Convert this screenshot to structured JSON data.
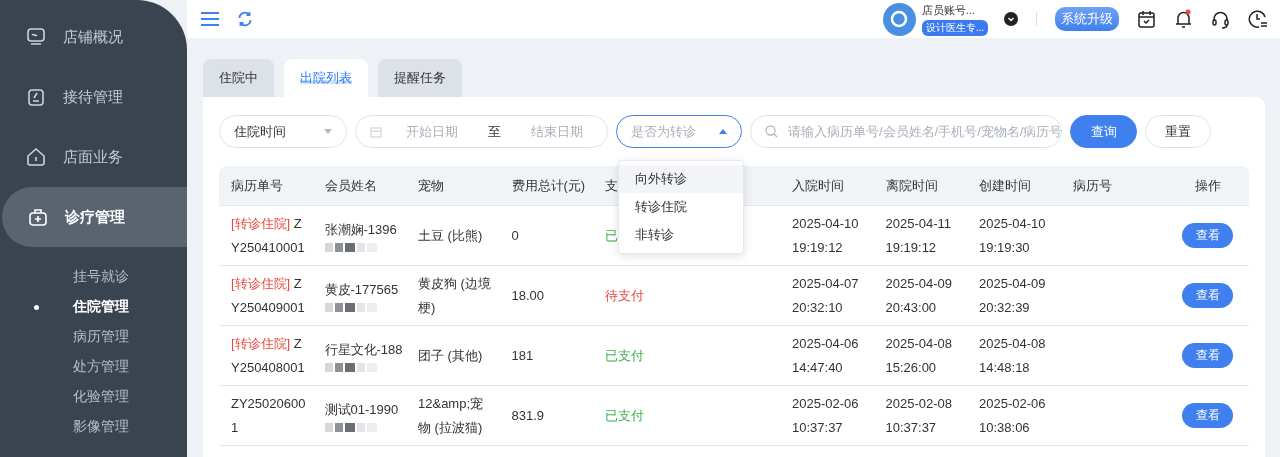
{
  "sidebar": {
    "items": [
      {
        "label": "店铺概况",
        "selected": false
      },
      {
        "label": "接待管理",
        "selected": false
      },
      {
        "label": "店面业务",
        "selected": false
      },
      {
        "label": "诊疗管理",
        "selected": true,
        "expanded": true,
        "children": [
          {
            "label": "挂号就诊",
            "selected": false
          },
          {
            "label": "住院管理",
            "selected": true
          },
          {
            "label": "病历管理",
            "selected": false
          },
          {
            "label": "处方管理",
            "selected": false
          },
          {
            "label": "化验管理",
            "selected": false
          },
          {
            "label": "影像管理",
            "selected": false
          }
        ]
      }
    ]
  },
  "header": {
    "account_name": "店员账号...",
    "account_role": "设计医生专...",
    "upgrade_button": "系统升级",
    "has_unread_notifications": true
  },
  "tabs": [
    {
      "label": "住院中",
      "selected": false
    },
    {
      "label": "出院列表",
      "selected": true
    },
    {
      "label": "提醒任务",
      "selected": false
    }
  ],
  "filters": {
    "date_type": "住院时间",
    "start_placeholder": "开始日期",
    "range_separator": "至",
    "end_placeholder": "结束日期",
    "transfer_select": {
      "placeholder": "是否为转诊",
      "open": true,
      "options": [
        {
          "label": "向外转诊",
          "highlighted": true
        },
        {
          "label": "转诊住院",
          "highlighted": false
        },
        {
          "label": "非转诊",
          "highlighted": false
        }
      ]
    },
    "search_placeholder": "请输入病历单号/会员姓名/手机号/宠物名/病历号",
    "query_button": "查询",
    "reset_button": "重置"
  },
  "table": {
    "columns": [
      "病历单号",
      "会员姓名",
      "宠物",
      "费用总计(元)",
      "支",
      "入院时间",
      "离院时间",
      "创建时间",
      "病历号",
      "操作"
    ],
    "rows": [
      {
        "transfer_tag": "[转诊住院]",
        "record_no": "ZY250410001",
        "member": "张潮娴-1396",
        "pet": "土豆 (比熊)",
        "total": "0",
        "payment": {
          "text": "已",
          "kind": "paid"
        },
        "admitted": [
          "2025-04-10",
          "19:19:12"
        ],
        "discharged": [
          "2025-04-11",
          "19:19:12"
        ],
        "created": [
          "2025-04-10",
          "19:19:30"
        ],
        "action": "查看"
      },
      {
        "transfer_tag": "[转诊住院]",
        "record_no": "ZY250409001",
        "member": "黄皮-177565",
        "pet": "黄皮狗 (边境梗)",
        "total": "18.00",
        "payment": {
          "text": "待支付",
          "kind": "unpaid"
        },
        "admitted": [
          "2025-04-07",
          "20:32:10"
        ],
        "discharged": [
          "2025-04-09",
          "20:43:00"
        ],
        "created": [
          "2025-04-09",
          "20:32:39"
        ],
        "action": "查看"
      },
      {
        "transfer_tag": "[转诊住院]",
        "record_no": "ZY250408001",
        "member": "行星文化-188",
        "pet": "团子 (其他)",
        "total": "181",
        "payment": {
          "text": "已支付",
          "kind": "paid"
        },
        "admitted": [
          "2025-04-06",
          "14:47:40"
        ],
        "discharged": [
          "2025-04-08",
          "15:26:00"
        ],
        "created": [
          "2025-04-08",
          "14:48:18"
        ],
        "action": "查看"
      },
      {
        "record_no": "ZY250206001",
        "member": "测试01-1990",
        "pet": "12&amp;宠物 (拉波猫)",
        "total": "831.9",
        "payment": {
          "text": "已支付",
          "kind": "paid"
        },
        "admitted": [
          "2025-02-06",
          "10:37:37"
        ],
        "discharged": [
          "2025-02-08",
          "10:37:37"
        ],
        "created": [
          "2025-02-06",
          "10:38:06"
        ],
        "action": "查看"
      }
    ]
  }
}
